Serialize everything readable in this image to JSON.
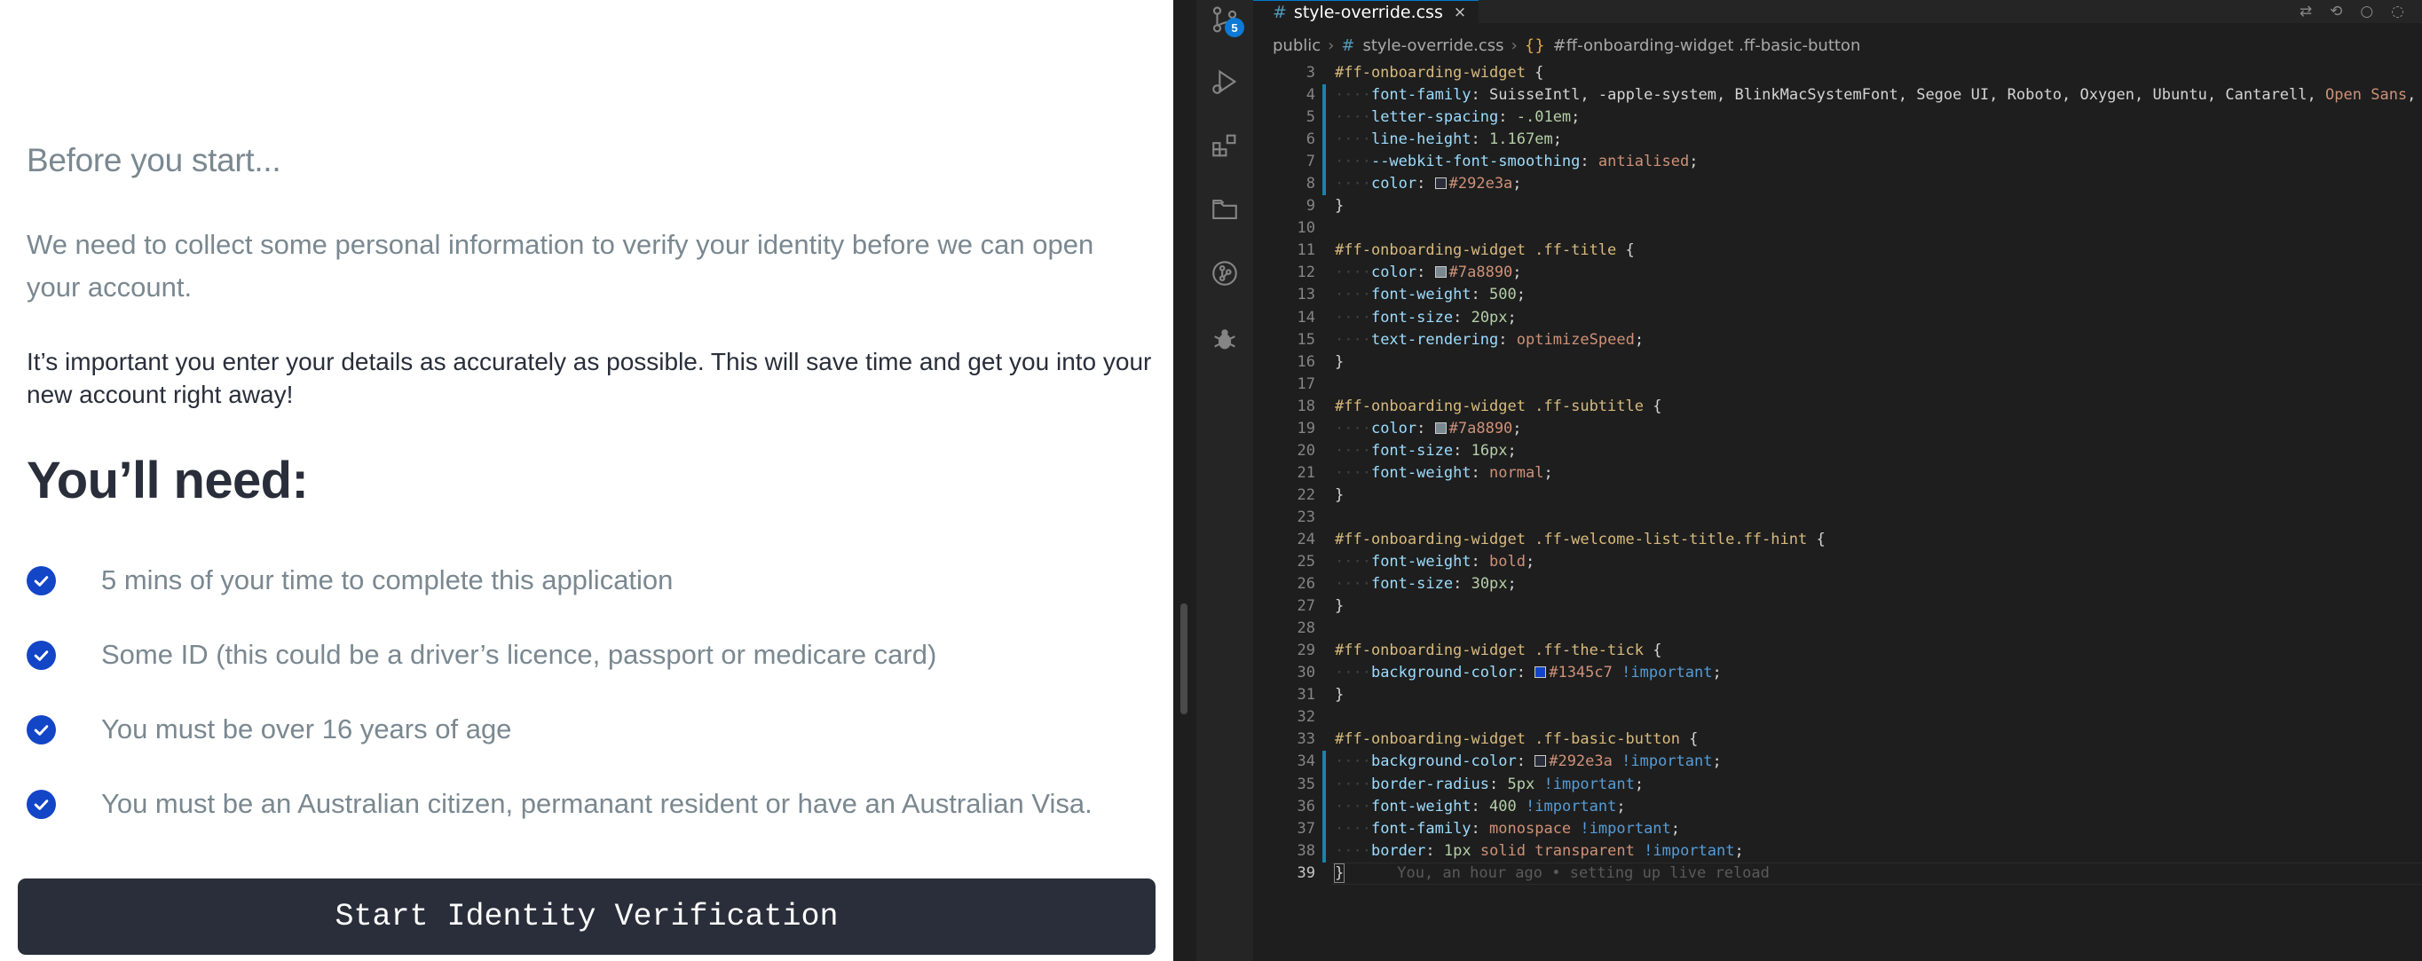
{
  "onboarding": {
    "before_start": "Before you start...",
    "intro": "We need to collect some personal information to verify your identity before we can open your account.",
    "important": "It’s important you enter your details as accurately as possible. This will save time and get you into your new account right away!",
    "you_need": "You’ll need:",
    "requirements": [
      "5 mins of your time to complete this application",
      "Some ID (this could be a driver’s licence, passport or medicare card)",
      "You must be over 16 years of age",
      "You must be an Australian citizen, permanant resident or have an Australian Visa."
    ],
    "start_button": "Start Identity Verification"
  },
  "vscode": {
    "activity_bar": {
      "icons": [
        "source-control-icon",
        "run-debug-icon",
        "extensions-icon",
        "folder-icon",
        "git-graph-icon",
        "debug-bug-icon"
      ],
      "scm_badge": "5"
    },
    "tab": {
      "hash": "#",
      "filename": "style-override.css",
      "close": "×"
    },
    "editor_actions": [
      "⇄",
      "⟲",
      "○",
      "◌"
    ],
    "breadcrumb": {
      "folder": "public",
      "file_hash": "#",
      "file": "style-override.css",
      "symbol_icon": "{}",
      "symbol": "#ff-onboarding-widget .ff-basic-button",
      "separator": "›"
    },
    "blame": "You, an hour ago • setting up live reload",
    "swatch_colors": {
      "292e3a": "#292e3a",
      "7a8890": "#7a8890",
      "1345c7": "#1345c7"
    },
    "code_lines": [
      {
        "n": "3",
        "t": "#ff-onboarding-widget {"
      },
      {
        "n": "4",
        "t": "    font-family: SuisseIntl, -apple-system, BlinkMacSystemFont, Segoe UI, Roboto, Oxygen, Ubuntu, Cantarell, Open Sans, He"
      },
      {
        "n": "5",
        "t": "    letter-spacing: -.01em;"
      },
      {
        "n": "6",
        "t": "    line-height: 1.167em;"
      },
      {
        "n": "7",
        "t": "    --webkit-font-smoothing: antialised;"
      },
      {
        "n": "8",
        "t": "    color: #292e3a;"
      },
      {
        "n": "9",
        "t": "}"
      },
      {
        "n": "10",
        "t": ""
      },
      {
        "n": "11",
        "t": "#ff-onboarding-widget .ff-title {"
      },
      {
        "n": "12",
        "t": "    color: #7a8890;"
      },
      {
        "n": "13",
        "t": "    font-weight: 500;"
      },
      {
        "n": "14",
        "t": "    font-size: 20px;"
      },
      {
        "n": "15",
        "t": "    text-rendering: optimizeSpeed;"
      },
      {
        "n": "16",
        "t": "}"
      },
      {
        "n": "17",
        "t": ""
      },
      {
        "n": "18",
        "t": "#ff-onboarding-widget .ff-subtitle {"
      },
      {
        "n": "19",
        "t": "    color: #7a8890;"
      },
      {
        "n": "20",
        "t": "    font-size: 16px;"
      },
      {
        "n": "21",
        "t": "    font-weight: normal;"
      },
      {
        "n": "22",
        "t": "}"
      },
      {
        "n": "23",
        "t": ""
      },
      {
        "n": "24",
        "t": "#ff-onboarding-widget .ff-welcome-list-title.ff-hint {"
      },
      {
        "n": "25",
        "t": "    font-weight: bold;"
      },
      {
        "n": "26",
        "t": "    font-size: 30px;"
      },
      {
        "n": "27",
        "t": "}"
      },
      {
        "n": "28",
        "t": ""
      },
      {
        "n": "29",
        "t": "#ff-onboarding-widget .ff-the-tick {"
      },
      {
        "n": "30",
        "t": "    background-color: #1345c7 !important;"
      },
      {
        "n": "31",
        "t": "}"
      },
      {
        "n": "32",
        "t": ""
      },
      {
        "n": "33",
        "t": "#ff-onboarding-widget .ff-basic-button {"
      },
      {
        "n": "34",
        "t": "    background-color: #292e3a !important;"
      },
      {
        "n": "35",
        "t": "    border-radius: 5px !important;"
      },
      {
        "n": "36",
        "t": "    font-weight: 400 !important;"
      },
      {
        "n": "37",
        "t": "    font-family: monospace !important;"
      },
      {
        "n": "38",
        "t": "    border: 1px solid transparent !important;"
      },
      {
        "n": "39",
        "t": "}"
      }
    ]
  }
}
